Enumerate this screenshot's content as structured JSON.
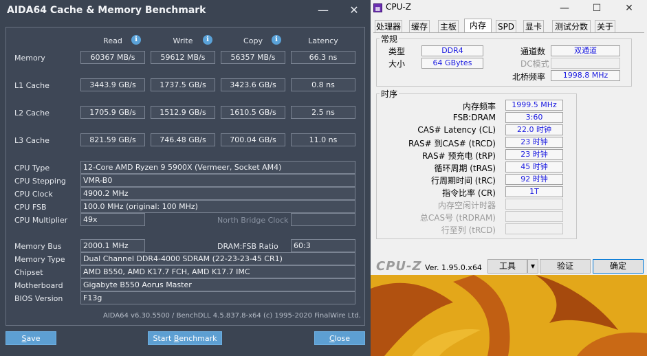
{
  "aida": {
    "title": "AIDA64 Cache & Memory Benchmark",
    "minimize": "—",
    "close": "✕",
    "columns": [
      "Read",
      "Write",
      "Copy",
      "Latency"
    ],
    "rows": [
      {
        "label": "Memory",
        "read": "60367 MB/s",
        "write": "59612 MB/s",
        "copy": "56357 MB/s",
        "latency": "66.3 ns"
      },
      {
        "label": "L1 Cache",
        "read": "3443.9 GB/s",
        "write": "1737.5 GB/s",
        "copy": "3423.6 GB/s",
        "latency": "0.8 ns"
      },
      {
        "label": "L2 Cache",
        "read": "1705.9 GB/s",
        "write": "1512.9 GB/s",
        "copy": "1610.5 GB/s",
        "latency": "2.5 ns"
      },
      {
        "label": "L3 Cache",
        "read": "821.59 GB/s",
        "write": "746.48 GB/s",
        "copy": "700.04 GB/s",
        "latency": "11.0 ns"
      }
    ],
    "cpu_type_label": "CPU Type",
    "cpu_type": "12-Core AMD Ryzen 9 5900X  (Vermeer, Socket AM4)",
    "cpu_stepping_label": "CPU Stepping",
    "cpu_stepping": "VMR-B0",
    "cpu_clock_label": "CPU Clock",
    "cpu_clock": "4900.2 MHz",
    "cpu_fsb_label": "CPU FSB",
    "cpu_fsb": "100.0 MHz  (original: 100 MHz)",
    "cpu_multiplier_label": "CPU Multiplier",
    "cpu_multiplier": "49x",
    "north_bridge_label": "North Bridge Clock",
    "north_bridge": "",
    "memory_bus_label": "Memory Bus",
    "memory_bus": "2000.1 MHz",
    "dram_ratio_label": "DRAM:FSB Ratio",
    "dram_ratio": "60:3",
    "memory_type_label": "Memory Type",
    "memory_type": "Dual Channel DDR4-4000 SDRAM  (22-23-23-45 CR1)",
    "chipset_label": "Chipset",
    "chipset": "AMD B550, AMD K17.7 FCH, AMD K17.7 IMC",
    "motherboard_label": "Motherboard",
    "motherboard": "Gigabyte B550 Aorus Master",
    "bios_label": "BIOS Version",
    "bios": "F13g",
    "footer": "AIDA64 v6.30.5500 / BenchDLL 4.5.837.8-x64  (c) 1995-2020 FinalWire Ltd.",
    "save_first": "S",
    "save_rest": "ave",
    "start_first": "Start ",
    "start_u": "B",
    "start_rest": "enchmark",
    "close_first": "C",
    "close_rest": "lose"
  },
  "cpuz": {
    "title": "CPU-Z",
    "tabs": [
      "处理器",
      "缓存",
      "主板",
      "内存",
      "SPD",
      "显卡",
      "测试分数",
      "关于"
    ],
    "active_tab": "内存",
    "general": {
      "group": "常规",
      "type_label": "类型",
      "type": "DDR4",
      "size_label": "大小",
      "size": "64 GBytes",
      "channels_label": "通道数",
      "channels": "双通道",
      "dc_label": "DC模式",
      "dc": "",
      "nb_label": "北桥频率",
      "nb": "1998.8 MHz"
    },
    "timings": {
      "group": "时序",
      "rows": [
        {
          "label": "内存频率",
          "value": "1999.5 MHz",
          "dim": false
        },
        {
          "label": "FSB:DRAM",
          "value": "3:60",
          "dim": false
        },
        {
          "label": "CAS# Latency (CL)",
          "value": "22.0 时钟",
          "dim": false
        },
        {
          "label": "RAS# 到CAS# (tRCD)",
          "value": "23 时钟",
          "dim": false
        },
        {
          "label": "RAS# 预充电 (tRP)",
          "value": "23 时钟",
          "dim": false
        },
        {
          "label": "循环周期 (tRAS)",
          "value": "45 时钟",
          "dim": false
        },
        {
          "label": "行周期时间 (tRC)",
          "value": "92 时钟",
          "dim": false
        },
        {
          "label": "指令比率 (CR)",
          "value": "1T",
          "dim": false
        },
        {
          "label": "内存空闲计时器",
          "value": "",
          "dim": true
        },
        {
          "label": "总CAS号 (tRDRAM)",
          "value": "",
          "dim": true
        },
        {
          "label": "行至列 (tRCD)",
          "value": "",
          "dim": true
        }
      ]
    },
    "brand": "CPU-Z",
    "version": "Ver. 1.95.0.x64",
    "tools_btn": "工具",
    "validate_btn": "验证",
    "ok_btn": "确定"
  }
}
